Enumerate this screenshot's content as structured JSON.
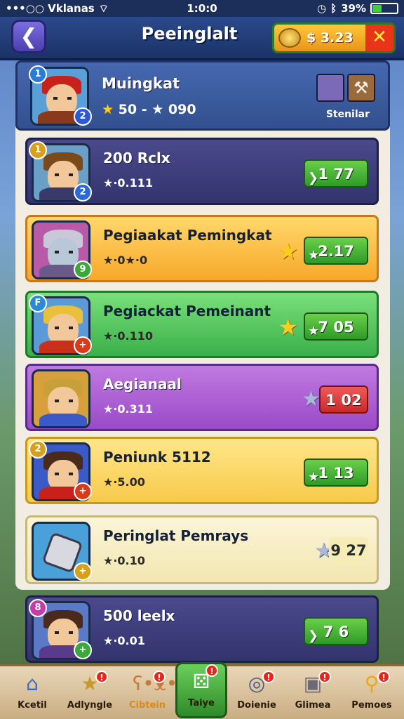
{
  "status_bar": {
    "carrier": "•••○○ Vklanas",
    "time": "1:0:0",
    "battery": "39%",
    "battery_level": 0.39
  },
  "header": {
    "title": "Peeinglalt",
    "coins": "$ 3.23"
  },
  "top_card": {
    "name": "Muingkat",
    "stats": "50 - ★ 090",
    "side_label": "Stenilar"
  },
  "rows": [
    {
      "title": "200 Rclx",
      "stats": "★·0.111",
      "value": "1 77",
      "theme": "purple"
    },
    {
      "title": "Pegiaakat Pemingkat",
      "stats": "★·0★·0",
      "value": "2.17",
      "theme": "orange"
    },
    {
      "title": "Pegiackat Pemeinant",
      "stats": "★·0.110",
      "value": "7 05",
      "theme": "green"
    },
    {
      "title": "Aegianaal",
      "stats": "★·0.311",
      "value": "1 02",
      "theme": "violet"
    },
    {
      "title": "Peniunk 5112",
      "stats": "★·5.00",
      "value": "1 13",
      "theme": "yellow"
    },
    {
      "title": "Peringlat Pemrays",
      "stats": "★·0.10",
      "value": "9 27",
      "theme": "cream"
    },
    {
      "title": "500 leelx",
      "stats": "★·0.01",
      "value": "7 6",
      "theme": "purple"
    }
  ],
  "nav": [
    {
      "label": "Kcetil",
      "icon": "home-icon",
      "badge": ""
    },
    {
      "label": "Adlyngle",
      "icon": "star-icon",
      "badge": "!"
    },
    {
      "label": "Cibtein",
      "icon": "bear-icon",
      "badge": "!"
    },
    {
      "label": "Taiye",
      "icon": "dice-icon",
      "badge": "!"
    },
    {
      "label": "Doienie",
      "icon": "target-icon",
      "badge": "!"
    },
    {
      "label": "Glimea",
      "icon": "robot-icon",
      "badge": "!"
    },
    {
      "label": "Pemoes",
      "icon": "magnifier-icon",
      "badge": "!"
    }
  ]
}
